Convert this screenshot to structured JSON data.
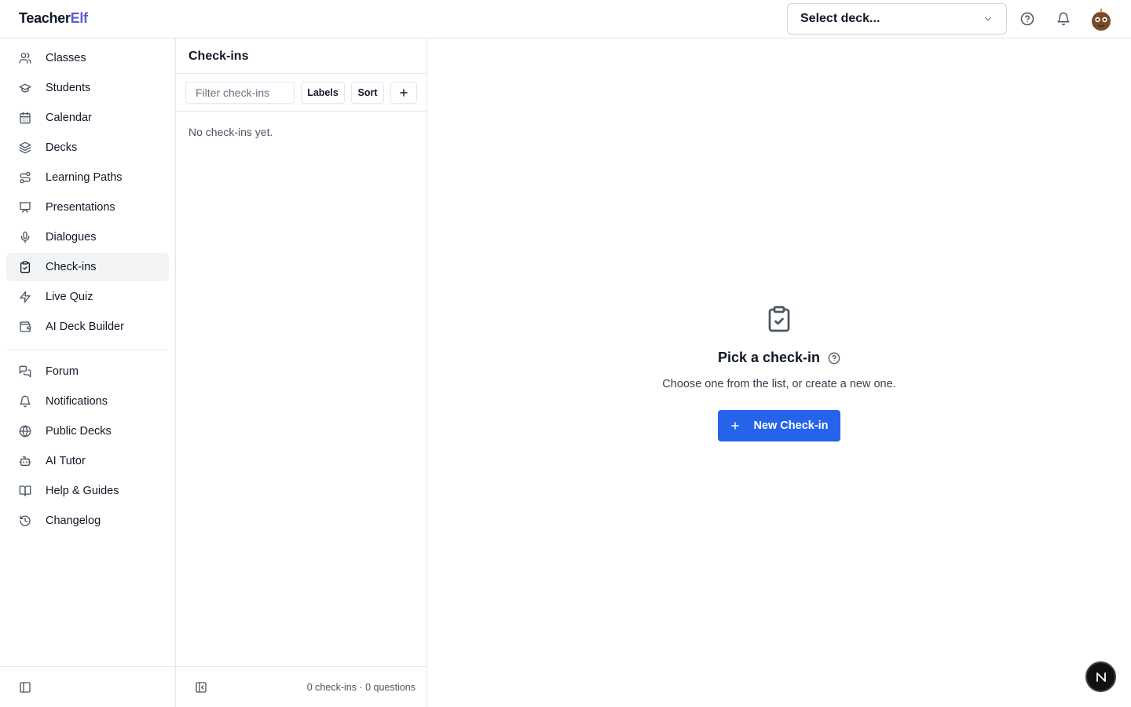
{
  "app": {
    "brand_part1": "Teacher",
    "brand_part2": "Elf"
  },
  "header": {
    "deck_select_placeholder": "Select deck..."
  },
  "sidebar": {
    "primary": [
      {
        "label": "Classes",
        "icon": "users-icon"
      },
      {
        "label": "Students",
        "icon": "graduation-cap-icon"
      },
      {
        "label": "Calendar",
        "icon": "calendar-icon"
      },
      {
        "label": "Decks",
        "icon": "layers-icon"
      },
      {
        "label": "Learning Paths",
        "icon": "route-icon"
      },
      {
        "label": "Presentations",
        "icon": "presentation-icon"
      },
      {
        "label": "Dialogues",
        "icon": "microphone-icon"
      },
      {
        "label": "Check-ins",
        "icon": "clipboard-check-icon",
        "active": true
      },
      {
        "label": "Live Quiz",
        "icon": "lightning-icon"
      },
      {
        "label": "AI Deck Builder",
        "icon": "wallet-icon"
      }
    ],
    "secondary": [
      {
        "label": "Forum",
        "icon": "chat-icon"
      },
      {
        "label": "Notifications",
        "icon": "bell-icon"
      },
      {
        "label": "Public Decks",
        "icon": "globe-icon"
      },
      {
        "label": "AI Tutor",
        "icon": "bot-icon"
      },
      {
        "label": "Help & Guides",
        "icon": "book-icon"
      },
      {
        "label": "Changelog",
        "icon": "history-icon"
      }
    ]
  },
  "list_panel": {
    "title": "Check-ins",
    "filter_placeholder": "Filter check-ins",
    "labels_button": "Labels",
    "sort_button": "Sort",
    "empty_text": "No check-ins yet.",
    "footer_counts": "0 check-ins · 0 questions"
  },
  "main": {
    "empty_title": "Pick a check-in",
    "empty_subtitle": "Choose one from the list, or create a new one.",
    "new_button": "New Check-in"
  },
  "colors": {
    "accent": "#2563eb",
    "brand": "#5b5bd6",
    "active_bg": "#f1f3f5"
  }
}
